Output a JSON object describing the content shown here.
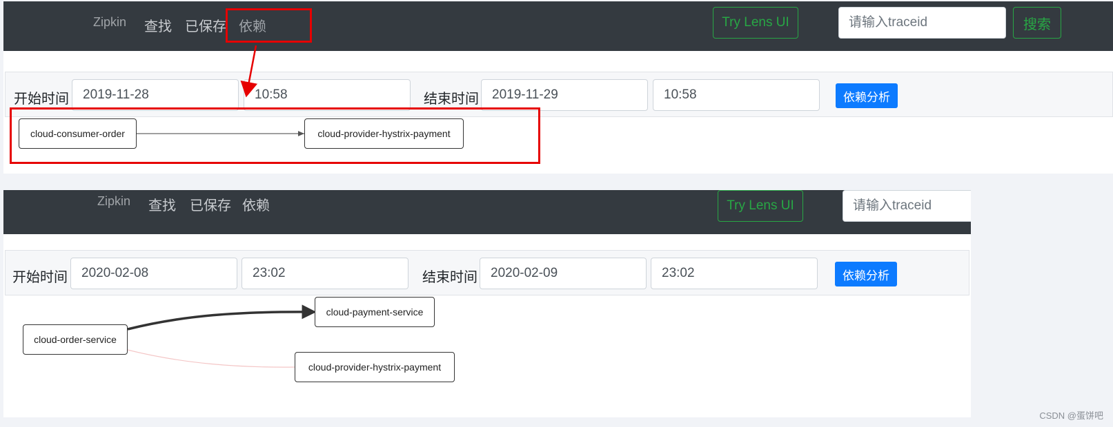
{
  "panels": [
    {
      "nav": {
        "brand": "Zipkin",
        "find": "查找",
        "saved": "已保存",
        "deps": "依赖",
        "lens": "Try Lens UI",
        "trace_placeholder": "请输入traceid",
        "search": "搜索"
      },
      "filters": {
        "start_label": "开始时间",
        "start_date": "2019-11-28",
        "start_time": "10:58",
        "end_label": "结束时间",
        "end_date": "2019-11-29",
        "end_time": "10:58",
        "analyze": "依赖分析"
      },
      "nodes": [
        "cloud-consumer-order",
        "cloud-provider-hystrix-payment"
      ]
    },
    {
      "nav": {
        "brand": "Zipkin",
        "find": "查找",
        "saved": "已保存",
        "deps": "依赖",
        "lens": "Try Lens UI",
        "trace_placeholder": "请输入traceid"
      },
      "filters": {
        "start_label": "开始时间",
        "start_date": "2020-02-08",
        "start_time": "23:02",
        "end_label": "结束时间",
        "end_date": "2020-02-09",
        "end_time": "23:02",
        "analyze": "依赖分析"
      },
      "nodes": [
        "cloud-payment-service",
        "cloud-order-service",
        "cloud-provider-hystrix-payment"
      ]
    }
  ],
  "colors": {
    "annotation": "#e60000",
    "nav_bg": "#343a40",
    "accent_green": "#28a745",
    "accent_blue": "#0d7bff"
  },
  "watermark": "CSDN @蛋饼吧"
}
